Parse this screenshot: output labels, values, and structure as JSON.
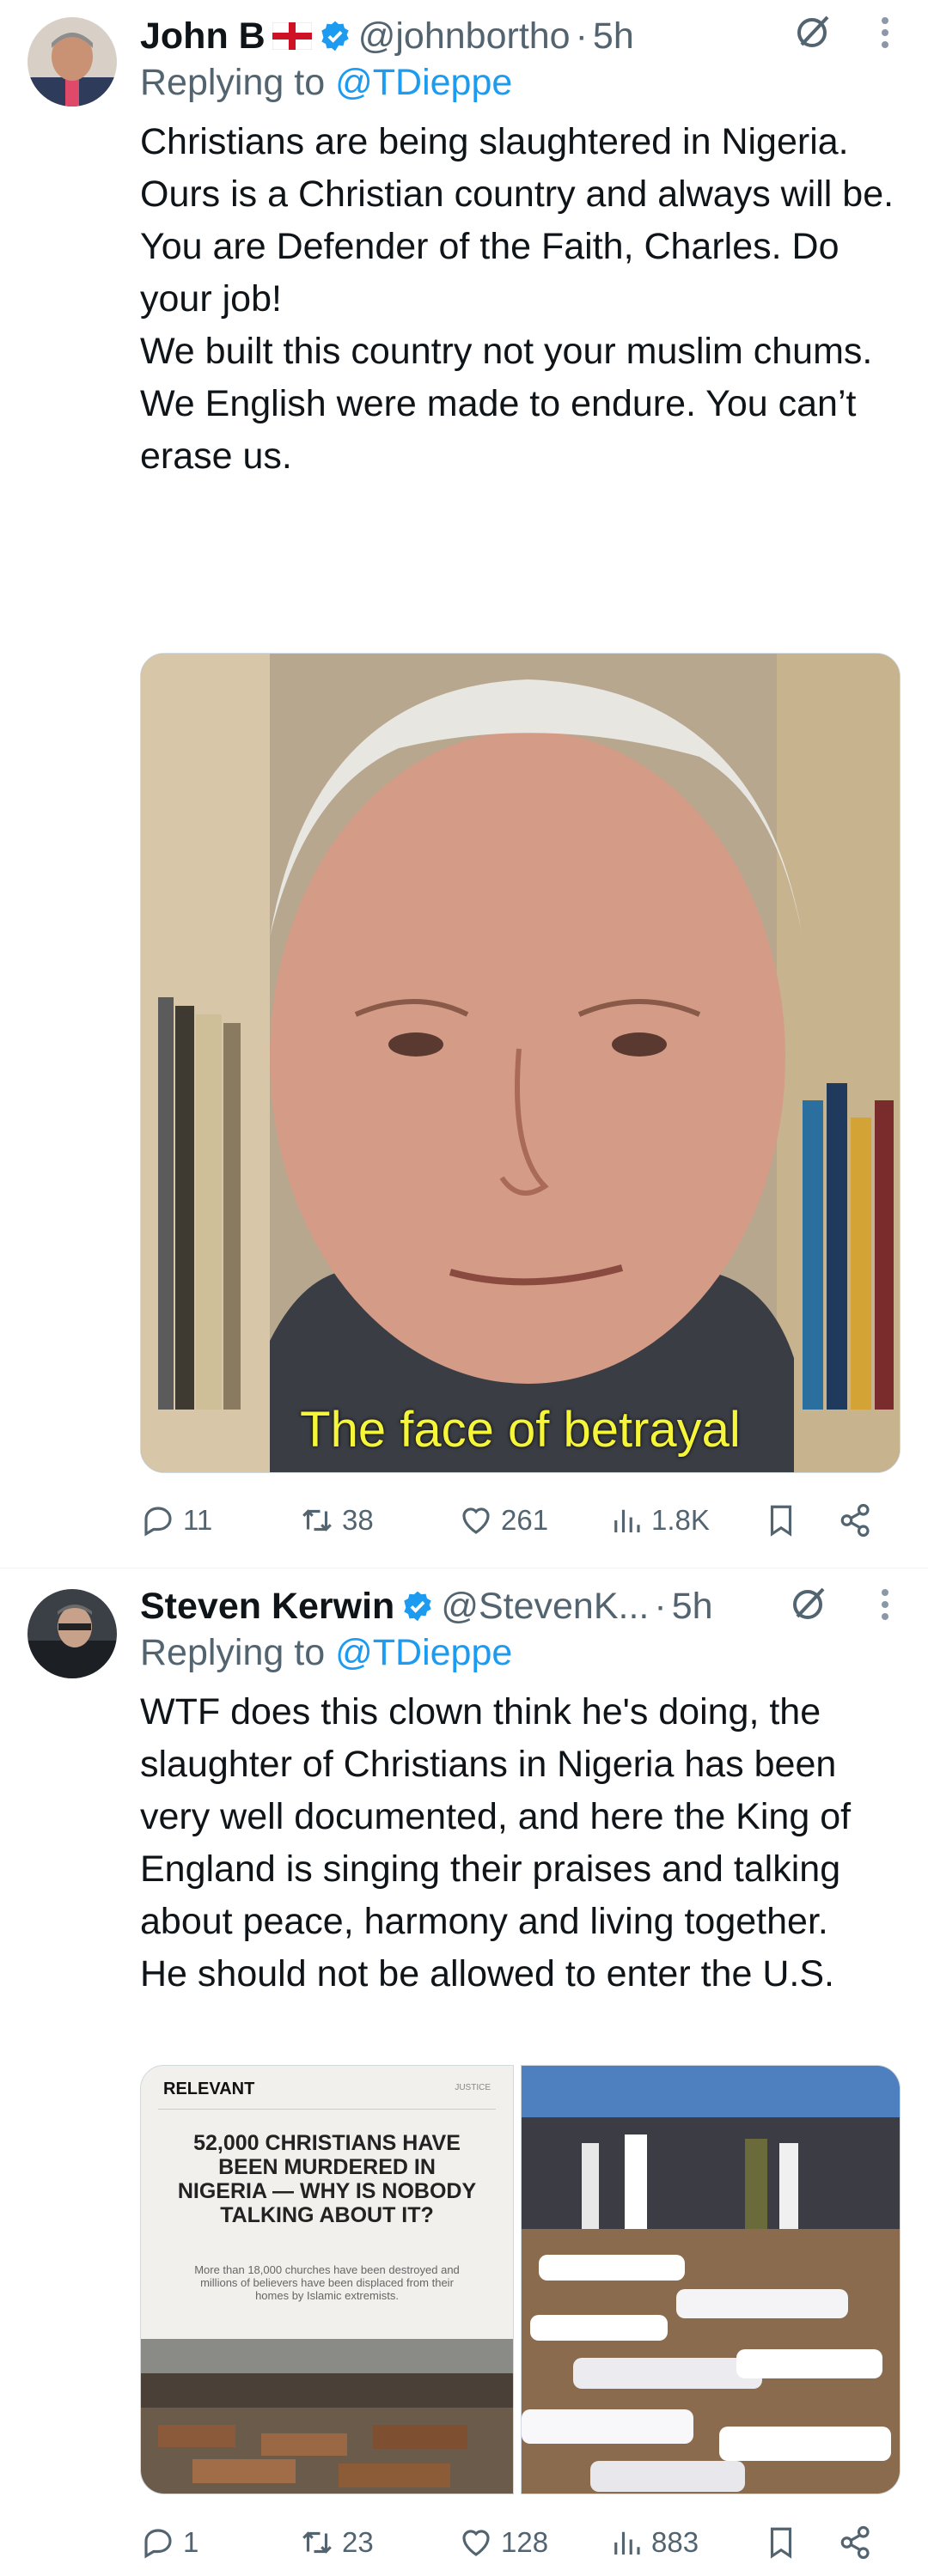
{
  "tweets": [
    {
      "name": "John B",
      "handle": "@johnbortho",
      "time": "5h",
      "replying_prefix": "Replying to",
      "replying_to": "@TDieppe",
      "lines": [
        "Christians are being slaughtered in Nigeria.",
        "Ours is a Christian country and always will be.",
        "You are Defender of the Faith, Charles. Do your job!",
        "We built this country not your muslim chums.",
        "We English were made to endure. You can’t erase us."
      ],
      "media_caption": "The face of betrayal",
      "media_colors": {
        "caption": "#f5f53a"
      },
      "stats": {
        "replies": "11",
        "reposts": "38",
        "likes": "261",
        "views": "1.8K"
      }
    },
    {
      "name": "Steven Kerwin",
      "handle": "@StevenK...",
      "time": "5h",
      "replying_prefix": "Replying to",
      "replying_to": "@TDieppe",
      "lines": [
        "WTF does this clown think he's doing, the slaughter of Christians in Nigeria has been very well documented, and here the King of England is singing their praises and talking about peace, harmony and living together.",
        "He should not be allowed to enter the U.S."
      ],
      "media_left": {
        "brand": "RELEVANT",
        "corner": "JUSTICE",
        "headline": "52,000 CHRISTIANS HAVE BEEN MURDERED IN NIGERIA — WHY IS NOBODY TALKING ABOUT IT?",
        "subtext": "More than 18,000 churches have been destroyed and millions of believers have been displaced from their homes by Islamic extremists."
      },
      "stats": {
        "replies": "1",
        "reposts": "23",
        "likes": "128",
        "views": "883"
      }
    }
  ],
  "colors": {
    "accent": "#1d9bf0",
    "muted": "#536471",
    "text": "#0f1419"
  },
  "icons": [
    "verified-badge-icon",
    "england-flag-icon",
    "grok-icon",
    "more-icon",
    "reply-icon",
    "repost-icon",
    "like-icon",
    "views-icon",
    "bookmark-icon",
    "share-icon"
  ]
}
